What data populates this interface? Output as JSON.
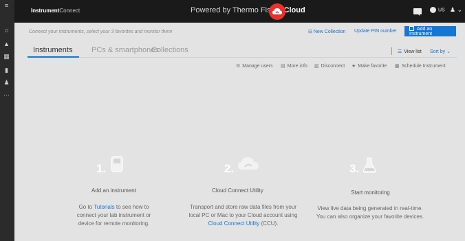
{
  "header": {
    "brand_bold": "Instrument",
    "brand_light": "Connect",
    "powered_by": "Powered by Thermo Fisher",
    "powered_cloud": "Cloud",
    "language": "US"
  },
  "subheader": {
    "hint": "Connect your instruments, select your 3 favorites and monitor them",
    "new_collection": "New Collection",
    "update_pin": "Update PIN number",
    "add_instrument": "Add an Instrument"
  },
  "tabs": [
    {
      "label": "Instruments",
      "active": true
    },
    {
      "label": "PCs & smartphones",
      "active": false
    },
    {
      "label": "Collections",
      "active": false
    }
  ],
  "view": {
    "view_list": "View list",
    "sort_by": "Sort by"
  },
  "actions": [
    {
      "label": "Manage users",
      "icon": "gear-icon"
    },
    {
      "label": "More info",
      "icon": "info-icon"
    },
    {
      "label": "Disconnect",
      "icon": "trash-icon"
    },
    {
      "label": "Make favorite",
      "icon": "star-icon"
    },
    {
      "label": "Schedule Instrument",
      "icon": "calendar-icon"
    }
  ],
  "steps": [
    {
      "number": "1.",
      "title": "Add an instrument",
      "desc_prefix": "Go to",
      "desc_link": "Tutorials",
      "desc_suffix": "to see how to connect your lab instrument or device for remote monitoring."
    },
    {
      "number": "2.",
      "title": "Cloud Connect Utility",
      "desc_prefix": "Transport and store raw data files from your local PC or Mac to your Cloud account using",
      "desc_link": "Cloud Connect Utility",
      "desc_suffix": "(CCU)."
    },
    {
      "number": "3.",
      "title": "Start monitoring",
      "desc_prefix": "View live data being generated in real-time. You can also organize your favorite devices.",
      "desc_link": "",
      "desc_suffix": ""
    }
  ],
  "colors": {
    "accent": "#1677d2",
    "header_bg": "#1a1a1a",
    "cloud_badge": "#e8322b",
    "page_bg": "#e3e3e3"
  }
}
